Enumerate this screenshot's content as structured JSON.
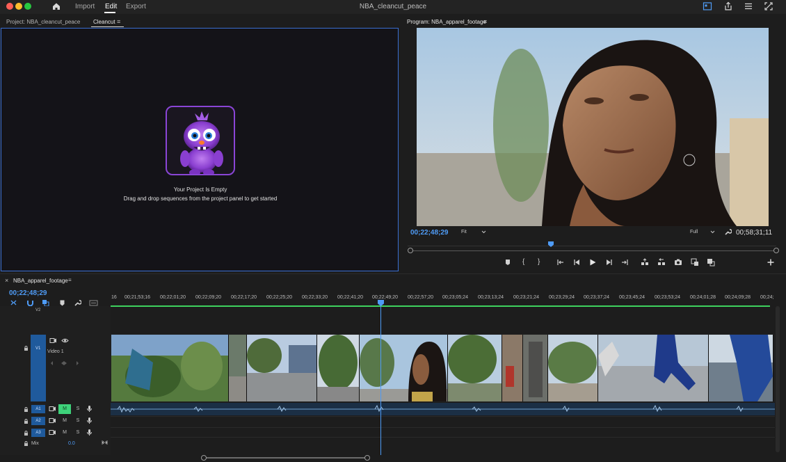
{
  "window": {
    "title": "NBA_cleancut_peace"
  },
  "nav": {
    "import": "Import",
    "edit": "Edit",
    "export": "Export"
  },
  "left_panel": {
    "tab_project": "Project: NBA_cleancut_peace",
    "tab_cleancut": "Cleancut",
    "menu_icon": "≡",
    "empty_title": "Your Project Is Empty",
    "empty_subtitle": "Drag and drop sequences from the project panel to get started"
  },
  "program": {
    "tab_label": "Program: NBA_apparel_footage",
    "menu_icon": "≡",
    "timecode_current": "00;22;48;29",
    "zoom_value": "Fit",
    "resolution_value": "Full",
    "timecode_total": "00;58;31;11"
  },
  "transport": {
    "mark_in": "{",
    "mark_out": "}"
  },
  "timeline": {
    "sequence_tab": "NBA_apparel_footage",
    "close_icon": "×",
    "menu_icon": "≡",
    "timecode": "00;22;48;29",
    "tracks": {
      "v2": "V2",
      "v1": "V1",
      "v1_name": "Video 1",
      "a1": "A1",
      "a2": "A2",
      "a3": "A3",
      "mute": "M",
      "solo": "S",
      "mix": "Mix",
      "mix_value": "0.0"
    },
    "ruler_start": "16",
    "ruler_labels": [
      "00;21;53;16",
      "00;22;01;20",
      "00;22;09;20",
      "00;22;17;20",
      "00;22;25;20",
      "00;22;33;20",
      "00;22;41;20",
      "00;22;49;20",
      "00;22;57;20",
      "00;23;05;24",
      "00;23;13;24",
      "00;23;21;24",
      "00;23;29;24",
      "00;23;37;24",
      "00;23;45;24",
      "00;23;53;24",
      "00;24;01;28",
      "00;24;09;28",
      "00;24;"
    ]
  },
  "colors": {
    "accent_blue": "#4f9cf7",
    "track_blue": "#1f5a9c",
    "green_bar": "#3ed25e",
    "mascot_purple": "#8a45d6"
  }
}
